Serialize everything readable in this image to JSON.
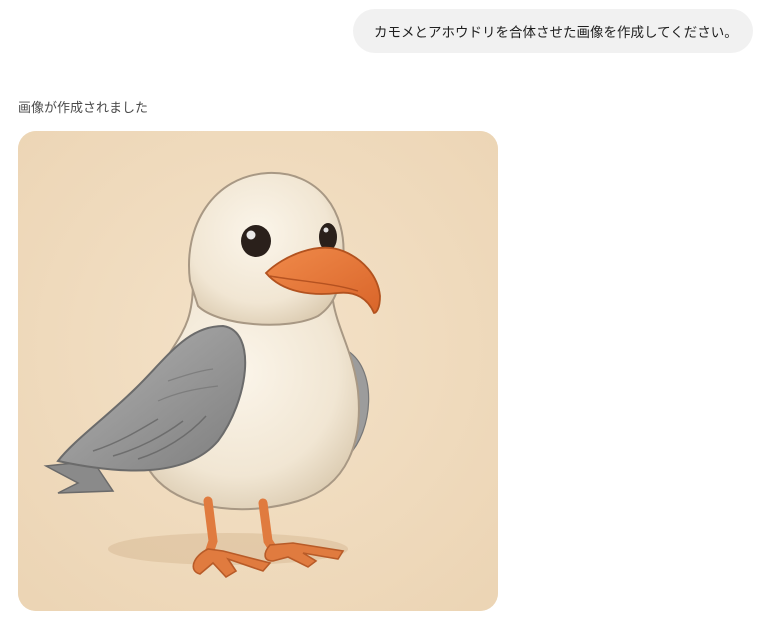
{
  "conversation": {
    "user_message": "カモメとアホウドリを合体させた画像を作成してください。",
    "assistant_status": "画像が作成されました"
  },
  "generated_image": {
    "subject": "gull-albatross-bird-illustration",
    "background_color": "#f1dcc0"
  }
}
